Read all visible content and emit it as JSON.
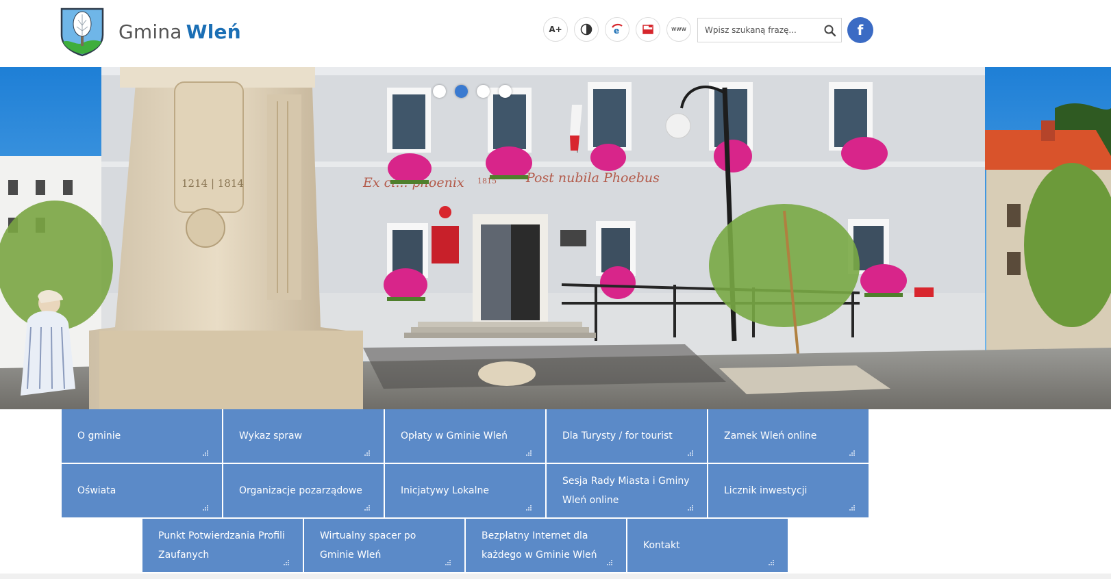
{
  "header": {
    "title_prefix": "Gmina",
    "title_name": "Wleń",
    "tools": [
      {
        "name": "font-size-button",
        "label": "A+",
        "icon": "font-size-icon"
      },
      {
        "name": "contrast-button",
        "label": "",
        "icon": "contrast-icon"
      },
      {
        "name": "epuap-button",
        "label": "",
        "icon": "epuap-icon"
      },
      {
        "name": "bip-button",
        "label": "",
        "icon": "bip-icon"
      },
      {
        "name": "www-button",
        "label": "www",
        "icon": "www-icon"
      }
    ],
    "search": {
      "placeholder": "Wpisz szukaną frazę...",
      "icon": "search-icon"
    },
    "facebook": {
      "label": "f",
      "icon": "facebook-icon",
      "color": "#3b6bc4"
    }
  },
  "hero": {
    "banner_text_left": "Ex ci... phoenix",
    "banner_text_year": "1815",
    "banner_text_right": "Post nubila Phoebus",
    "fountain_years": "1214 | 1814",
    "slides": 4,
    "active_slide": 2
  },
  "menu": {
    "row1": [
      "O gminie",
      "Wykaz spraw",
      "Opłaty w Gminie Wleń",
      "Dla Turysty / for tourist",
      "Zamek Wleń online"
    ],
    "row2": [
      "Oświata",
      "Organizacje pozarządowe",
      "Inicjatywy Lokalne",
      "Sesja Rady Miasta i Gminy Wleń online",
      "Licznik inwestycji"
    ],
    "row3": [
      "Punkt Potwierdzania Profili Zaufanych",
      "Wirtualny spacer po Gminie Wleń",
      "Bezpłatny Internet dla każdego w Gminie Wleń",
      "Kontakt"
    ]
  },
  "colors": {
    "tile": "#5b8ac8",
    "brand": "#1b6fb5",
    "active_dot": "#3a7ad0"
  }
}
